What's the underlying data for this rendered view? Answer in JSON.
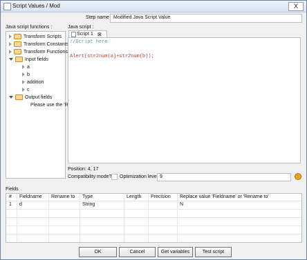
{
  "window": {
    "title": "Script Values / Mod",
    "close_label": "X"
  },
  "stepname": {
    "label": "Step name",
    "value": "Modified Java Script Value"
  },
  "functions": {
    "label": "Java script functions :",
    "items": [
      {
        "label": "Transform Scripts"
      },
      {
        "label": "Transform Constants"
      },
      {
        "label": "Transform Functions"
      }
    ],
    "input_fields": {
      "label": "Input fields",
      "items": [
        "a",
        "b",
        "addition",
        "c"
      ]
    },
    "output_fields": {
      "label": "Output fields",
      "note": "Please use the 'Re"
    }
  },
  "editor": {
    "label": "Java script :",
    "tab": "Script 1",
    "tab_close": "⊠",
    "comment": "//Script here",
    "line2": "Alert(str2num(a)+str2num(b));"
  },
  "position": {
    "text": "Position: 4, 17"
  },
  "compat": {
    "label": "Compatibility mode?"
  },
  "optim": {
    "label": "Optimization level",
    "value": "9"
  },
  "fields": {
    "label": "Fields",
    "headers": [
      "#",
      "Fieldname",
      "Rename to",
      "Type",
      "Length",
      "Precision",
      "Replace value 'Fieldname' or 'Rename to'"
    ],
    "rows": [
      [
        "1",
        "d",
        "",
        "String",
        "",
        "",
        "N"
      ]
    ]
  },
  "buttons": {
    "ok": "OK",
    "cancel": "Cancel",
    "get": "Get variables",
    "test": "Test script"
  }
}
